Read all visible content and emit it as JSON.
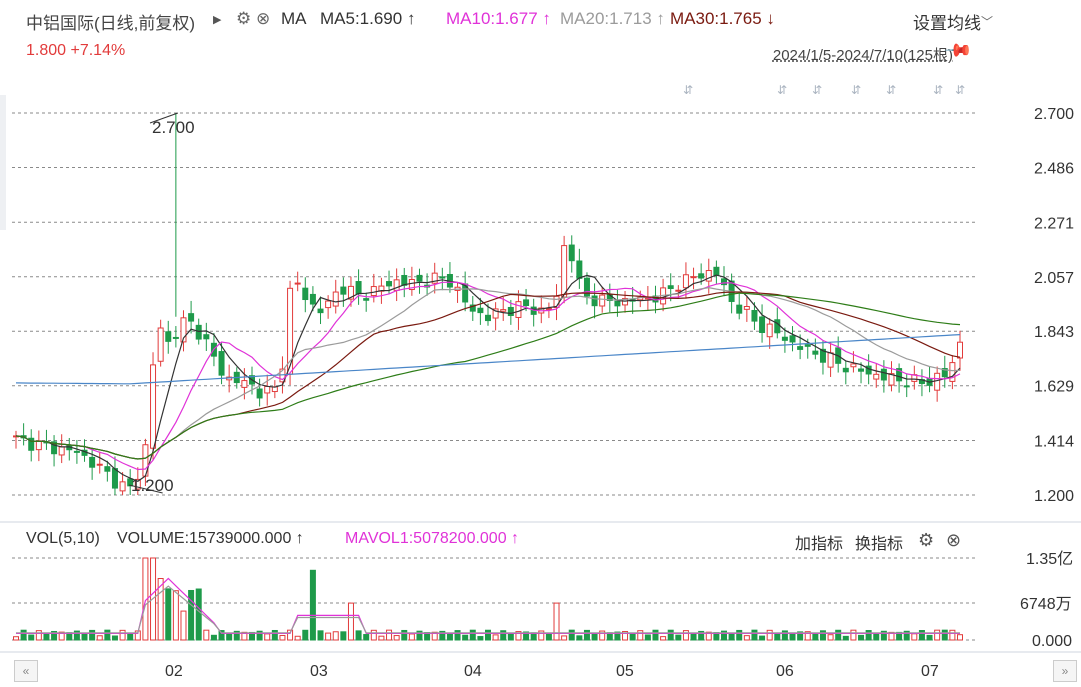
{
  "header": {
    "title": "中铝国际(日线,前复权)",
    "ma_label": "MA",
    "ma5": "MA5:1.690 ↑",
    "ma10": "MA10:1.677 ↑",
    "ma20": "MA20:1.713 ↑",
    "ma30": "MA30:1.765 ↓",
    "settings_label": "设置均线",
    "price": "1.800 +7.14%",
    "range": "2024/1/5-2024/7/10(125根)"
  },
  "volume_header": {
    "label": "VOL(5,10)",
    "volume": "VOLUME:15739000.000 ↑",
    "mavol1": "MAVOL1:5078200.000 ↑",
    "add_indicator": "加指标",
    "swap_indicator": "换指标"
  },
  "colors": {
    "up": "#e23b3b",
    "down": "#1e9a4a",
    "ma5": "#333333",
    "ma10": "#e032d8",
    "ma20": "#9b9b9b",
    "ma30": "#7a1a10",
    "ma60": "#2e7d18",
    "ma250": "#4a86c8"
  },
  "icons": [
    "play-icon",
    "gear-icon",
    "close-icon",
    "chevron-down-icon",
    "pin-icon",
    "scroll-left-icon",
    "scroll-right-icon"
  ],
  "chart_data": {
    "type": "candlestick",
    "title": "中铝国际(日线,前复权)",
    "x_tick_labels": [
      "02",
      "03",
      "04",
      "05",
      "06",
      "07"
    ],
    "y_ticks": [
      "2.700",
      "2.486",
      "2.271",
      "2.057",
      "1.843",
      "1.629",
      "1.414",
      "1.200"
    ],
    "ylim": [
      1.2,
      2.7
    ],
    "annotations": [
      "2.700",
      "1.200"
    ],
    "last_close": 1.8,
    "change_pct": "+7.14%",
    "volume_y_ticks": [
      "1.35亿",
      "6748万",
      "0.000"
    ],
    "volume_ylim": [
      0,
      135000000
    ]
  }
}
